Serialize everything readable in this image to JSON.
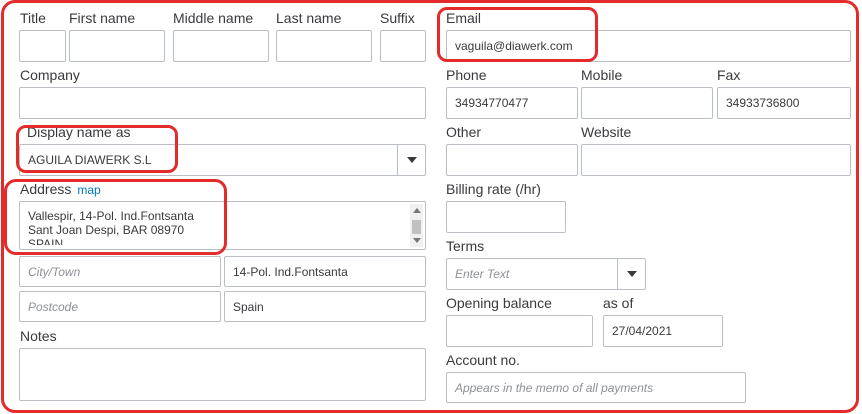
{
  "labels": {
    "title": "Title",
    "first_name": "First name",
    "middle_name": "Middle name",
    "last_name": "Last name",
    "suffix": "Suffix",
    "email": "Email",
    "company": "Company",
    "phone": "Phone",
    "mobile": "Mobile",
    "fax": "Fax",
    "display_name": "Display name as",
    "other": "Other",
    "website": "Website",
    "address": "Address",
    "map": "map",
    "billing_rate": "Billing rate (/hr)",
    "terms": "Terms",
    "opening_balance": "Opening balance",
    "as_of": "as of",
    "notes": "Notes",
    "account_no": "Account no."
  },
  "values": {
    "email": "vaguila@diawerk.com",
    "phone": "34934770477",
    "fax": "34933736800",
    "display_name": "AGUILA DIAWERK S.L",
    "address_line1": "Vallespir, 14-Pol. Ind.Fontsanta",
    "address_line2": "Sant Joan Despi, BAR 08970",
    "address_line3": "SPAIN",
    "state": "14-Pol. Ind.Fontsanta",
    "country": "Spain",
    "as_of_date": "27/04/2021"
  },
  "placeholders": {
    "city": "City/Town",
    "postcode": "Postcode",
    "terms": "Enter Text",
    "account_no": "Appears in the memo of all payments"
  },
  "colors": {
    "highlight": "#e32b2b",
    "border": "#babec5",
    "link": "#0077c5"
  }
}
